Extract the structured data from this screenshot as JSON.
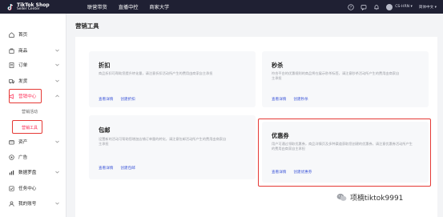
{
  "header": {
    "logo_line1": "TikTok Shop",
    "logo_line2": "Seller Center",
    "nav": [
      "联营带货",
      "直播中控",
      "商家大学"
    ],
    "user": "CS-HRN ▾",
    "language": "简体中文 ▾"
  },
  "sidebar": {
    "items": [
      {
        "label": "首页",
        "icon": "home-icon"
      },
      {
        "label": "商品",
        "icon": "goods-icon"
      },
      {
        "label": "订单",
        "icon": "order-icon"
      },
      {
        "label": "发货",
        "icon": "shipping-icon"
      },
      {
        "label": "营销中心",
        "icon": "marketing-icon"
      },
      {
        "label": "资产",
        "icon": "assets-icon"
      },
      {
        "label": "广告",
        "icon": "ads-icon"
      },
      {
        "label": "数据罗盘",
        "icon": "data-compass-icon"
      },
      {
        "label": "任务中心",
        "icon": "task-icon"
      },
      {
        "label": "我的账号",
        "icon": "account-icon"
      }
    ],
    "sub_items": [
      "营销活动",
      "营销工具"
    ]
  },
  "main": {
    "title": "营销工具",
    "cards": [
      {
        "title": "折扣",
        "desc": "商品折扣可帮助您提升转化量，请注意折扣活动所产生的费用由商家自主承担",
        "link1": "查看详情",
        "link2": "创建折扣"
      },
      {
        "title": "秒杀",
        "desc": "符合平台的优惠规则的商品将在展示秒杀标签，请注意秒杀活动所产生的费用由商家自主承担",
        "link1": "查看详情",
        "link2": "创建秒杀"
      },
      {
        "title": "包邮",
        "desc": "设置新的活动可帮助您增加店铺订单量的转化，请注意包邮活动所产生的费用由商家自主承担",
        "link1": "查看详情",
        "link2": "创建包邮"
      },
      {
        "title": "优惠券",
        "desc": "用户可通过领取优惠券，商品详情页及多种渠道获取您创建的优惠券，请注意优惠券活动所产生的费用由商家自主承担",
        "link1": "查看详情",
        "link2": "创建优惠券"
      }
    ]
  },
  "watermark": "项楠tiktok9991",
  "colors": {
    "topbar": "#1f2033",
    "accent": "#fe2c55",
    "link": "#3c55d8",
    "highlight": "#e53935"
  }
}
